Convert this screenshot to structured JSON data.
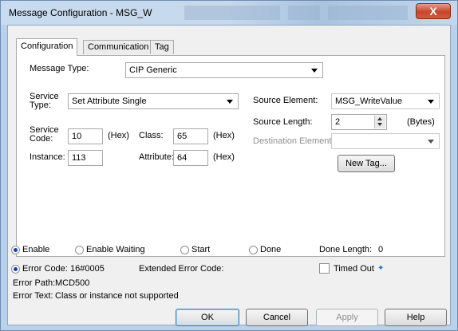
{
  "window": {
    "title": "Message Configuration - MSG_W",
    "close_glyph": "X"
  },
  "tabs": [
    "Configuration",
    "Communication",
    "Tag"
  ],
  "config": {
    "message_type_label": "Message Type:",
    "message_type_value": "CIP Generic",
    "service_type_label": "Service\nType:",
    "service_type_value": "Set Attribute Single",
    "service_code_label": "Service\nCode:",
    "service_code_value": "10",
    "hex_unit": "(Hex)",
    "class_label": "Class:",
    "class_value": "65",
    "instance_label": "Instance:",
    "instance_value": "113",
    "attribute_label": "Attribute:",
    "attribute_value": "64",
    "source_element_label": "Source Element:",
    "source_element_value": "MSG_WriteValue",
    "source_length_label": "Source Length:",
    "source_length_value": "2",
    "bytes_unit": "(Bytes)",
    "destination_element_label": "Destination Element:",
    "destination_element_value": "",
    "new_tag_label": "New Tag..."
  },
  "status": {
    "enable_label": "Enable",
    "enable_waiting_label": "Enable Waiting",
    "start_label": "Start",
    "done_label": "Done",
    "done_length_label": "Done Length:",
    "done_length_value": "0",
    "error_code_label": "Error Code:",
    "error_code_value": "16#0005",
    "extended_error_label": "Extended Error Code:",
    "timed_out_label": "Timed Out",
    "timed_out_marker": "✦",
    "error_path_label": "Error Path:",
    "error_path_value": "MCD500",
    "error_text_label": "Error Text:",
    "error_text_value": "Class or instance not supported"
  },
  "buttons": {
    "ok": "OK",
    "cancel": "Cancel",
    "apply": "Apply",
    "help": "Help"
  },
  "colors": {
    "titlebar": "#c6d8ec",
    "close": "#c7452a",
    "radio_dot": "#1a3fa8"
  }
}
